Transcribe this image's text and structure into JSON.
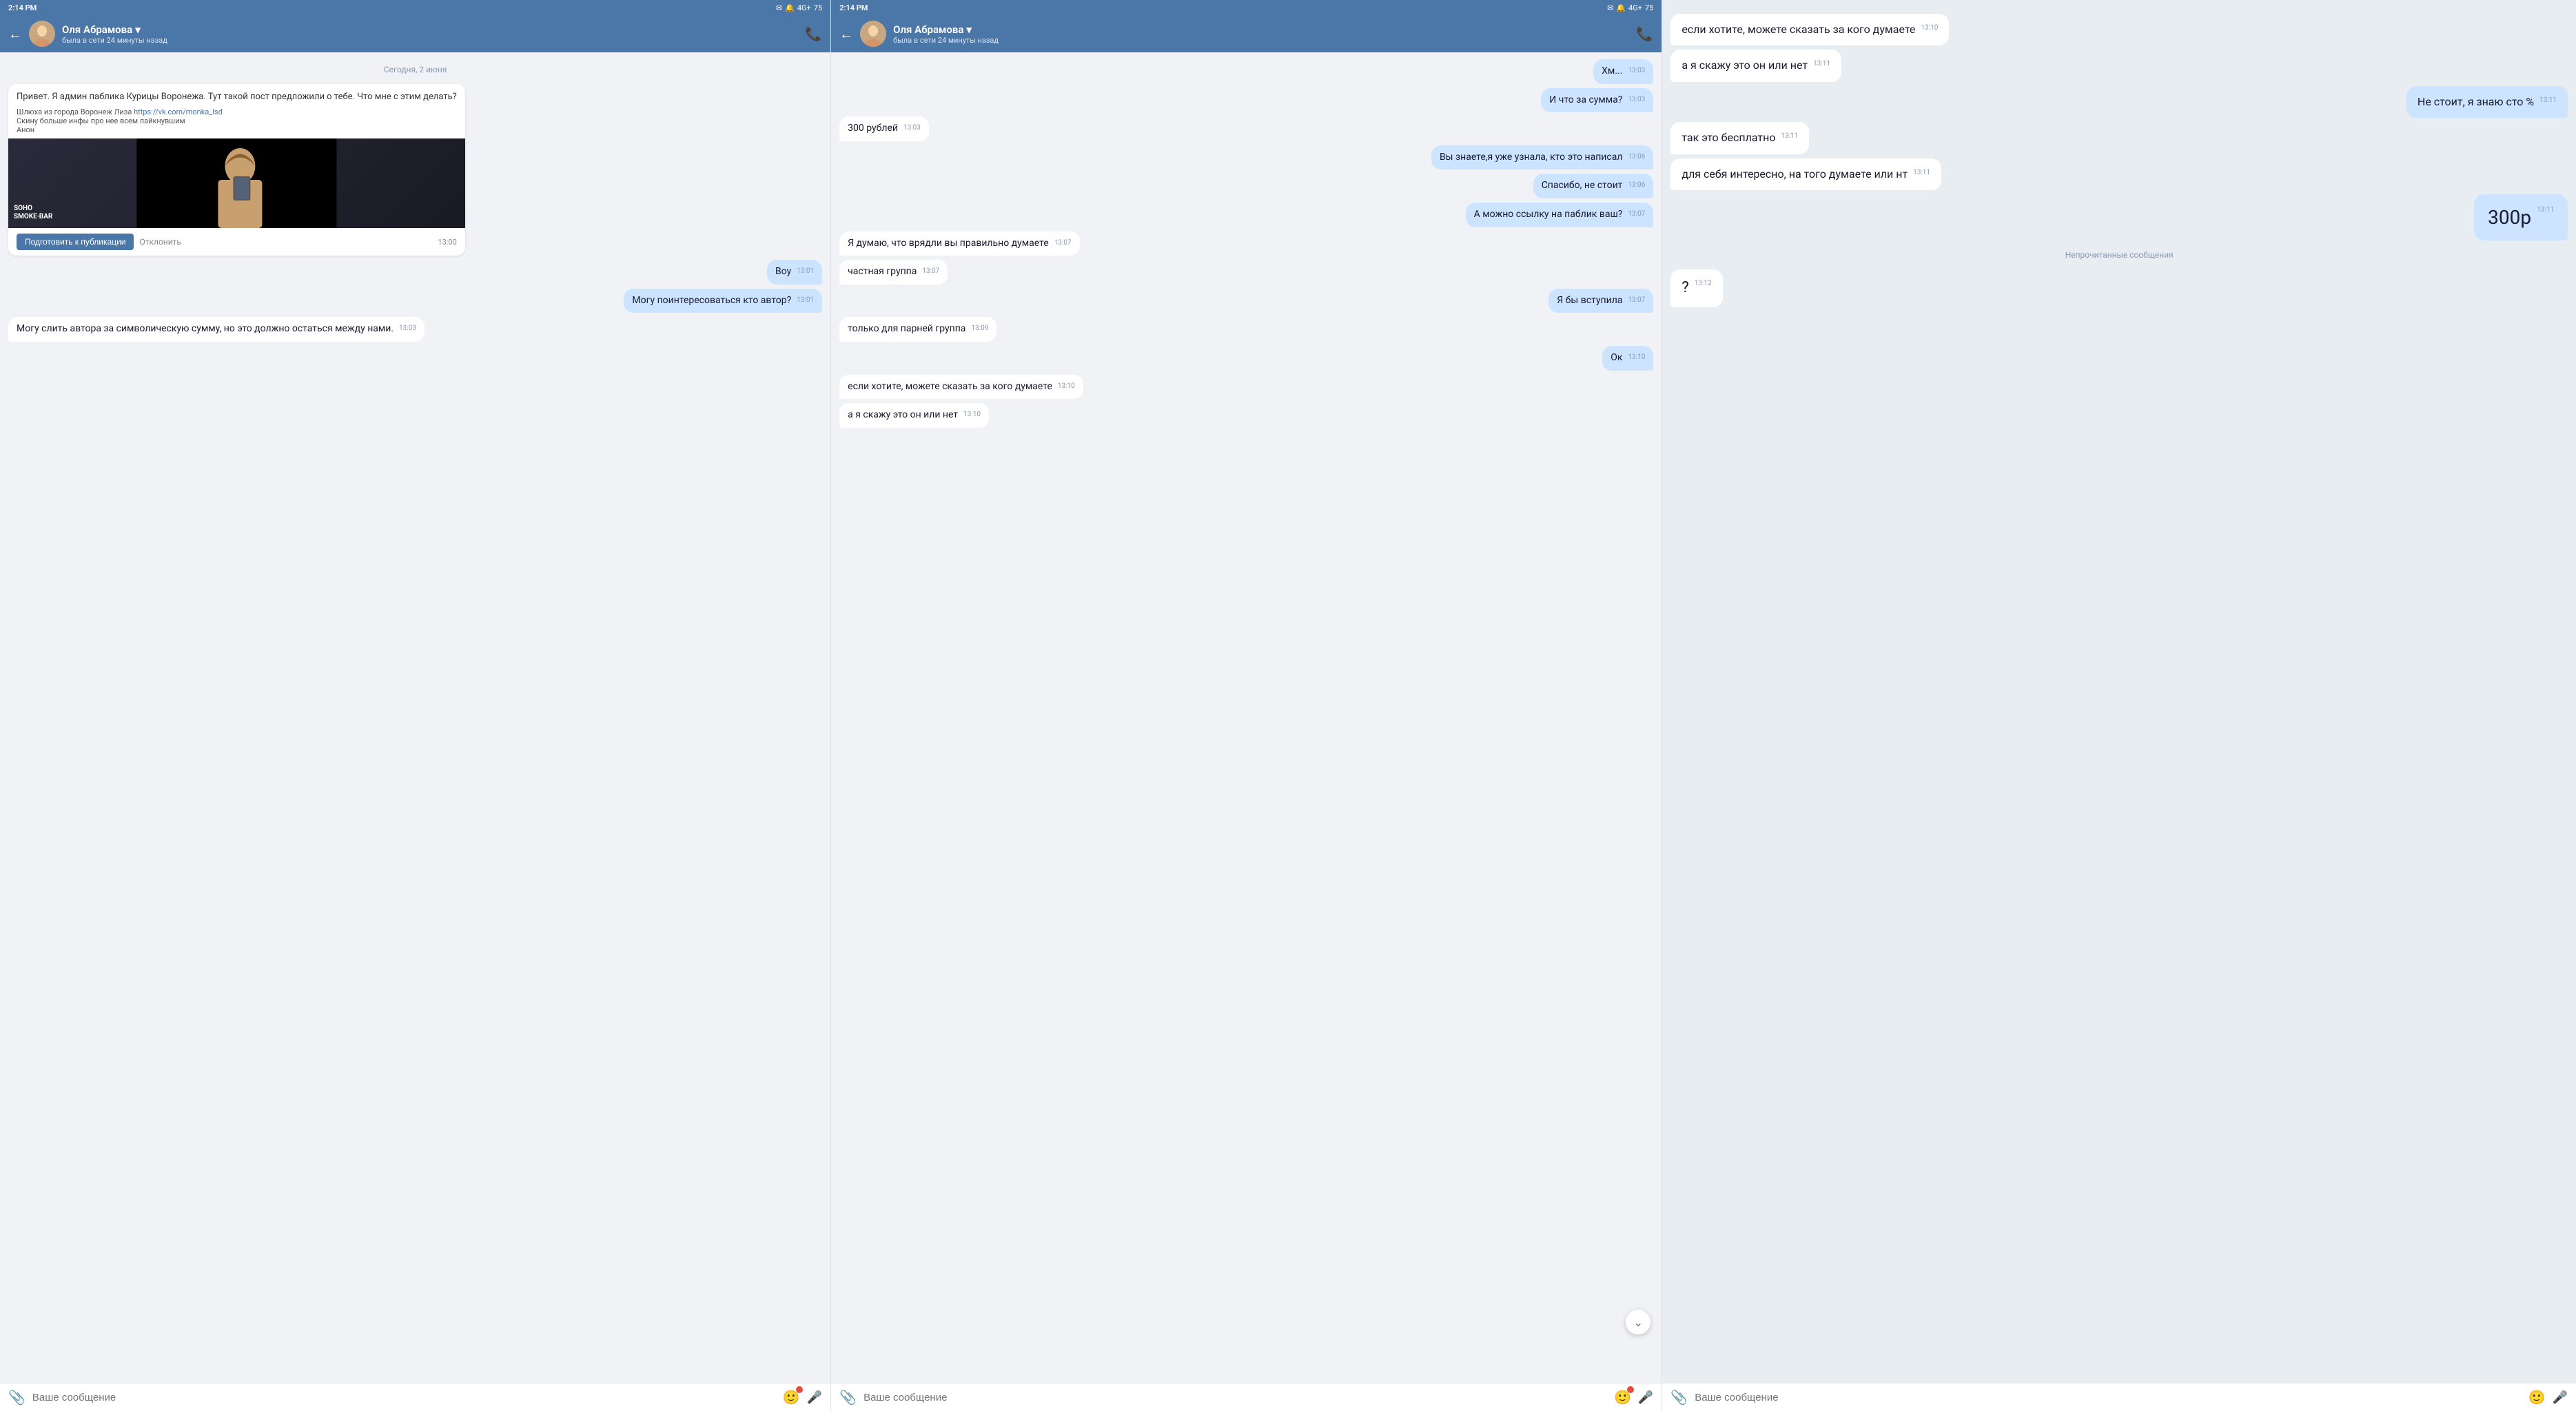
{
  "panels": [
    {
      "id": "panel-left",
      "statusBar": {
        "time": "2:14 PM",
        "icons": "📧 🔔 4G+ 75"
      },
      "header": {
        "name": "Оля Абрамова",
        "status": "была в сети 24 минуты назад",
        "callIcon": "📞"
      },
      "dateDivider": "Сегодня, 2 июня",
      "messages": [
        {
          "type": "card",
          "direction": "incoming",
          "text": "Привет. Я админ паблика Курицы Воронежа. Тут такой пост предложили о тебе. Что мне с этим делать?",
          "cardMeta": "Шлюха из города Воронеж Лиза https://vk.com/monka_lsd\nСкину больше инфы про нее всем лайкнувшим\nАнон",
          "hasImage": true,
          "actions": [
            "Подготовить к публикации",
            "Отклонить"
          ],
          "time": "13:00"
        },
        {
          "direction": "outgoing",
          "text": "Воу",
          "time": "13:01"
        },
        {
          "direction": "outgoing",
          "text": "Могу поинтересоваться кто автор?",
          "time": "13:01"
        },
        {
          "direction": "incoming",
          "text": "Могу слить автора за символическую сумму, но это должно остаться между нами.",
          "time": "13:03"
        }
      ],
      "inputPlaceholder": "Ваше сообщение"
    },
    {
      "id": "panel-middle",
      "statusBar": {
        "time": "2:14 PM",
        "icons": "📧 🔔 4G+ 75"
      },
      "header": {
        "name": "Оля Абрамова",
        "status": "была в сети 24 минуты назад",
        "callIcon": "📞"
      },
      "messages": [
        {
          "direction": "outgoing",
          "text": "Хм...",
          "time": "13:03"
        },
        {
          "direction": "outgoing",
          "text": "И что за сумма?",
          "time": "13:03"
        },
        {
          "direction": "incoming",
          "text": "300 рублей",
          "time": "13:03"
        },
        {
          "direction": "outgoing",
          "text": "Вы знаете,я уже узнала, кто это написал",
          "time": "13:06"
        },
        {
          "direction": "outgoing",
          "text": "Спасибо, не стоит",
          "time": "13:06"
        },
        {
          "direction": "outgoing",
          "text": "А можно ссылку на паблик ваш?",
          "time": "13:07"
        },
        {
          "direction": "incoming",
          "text": "Я думаю, что врядли вы правильно думаете",
          "time": "13:07"
        },
        {
          "direction": "incoming",
          "text": "частная группа",
          "time": "13:07"
        },
        {
          "direction": "outgoing",
          "text": "Я бы вступила",
          "time": "13:07"
        },
        {
          "direction": "incoming",
          "text": "только для парней группа",
          "time": "13:09"
        },
        {
          "direction": "outgoing",
          "text": "Ок",
          "time": "13:10"
        },
        {
          "direction": "incoming",
          "text": "если хотите, можете сказать за кого думаете",
          "time": "13:10"
        },
        {
          "direction": "incoming",
          "text": "а я скажу это он или нет",
          "time": "13:10"
        }
      ],
      "inputPlaceholder": "Ваше сообщение"
    },
    {
      "id": "panel-right",
      "messages": [
        {
          "direction": "incoming",
          "text": "если хотите, можете сказать за кого думаете",
          "time": "13:10"
        },
        {
          "direction": "incoming",
          "text": "а я скажу это он или нет",
          "time": "13:11"
        },
        {
          "direction": "outgoing",
          "text": "Не стоит, я знаю сто %",
          "time": "13:11"
        },
        {
          "direction": "incoming",
          "text": "так это бесплатно",
          "time": "13:11"
        },
        {
          "direction": "incoming",
          "text": "для себя интересно, на того думаете или нт",
          "time": "13:11"
        },
        {
          "direction": "outgoing",
          "text": "300р",
          "time": "13:11",
          "bigText": true
        },
        {
          "type": "unread_divider",
          "text": "Непрочитанные сообщения"
        },
        {
          "direction": "incoming",
          "text": "?",
          "time": "13:12"
        }
      ],
      "inputPlaceholder": "Ваше сообщение"
    }
  ]
}
